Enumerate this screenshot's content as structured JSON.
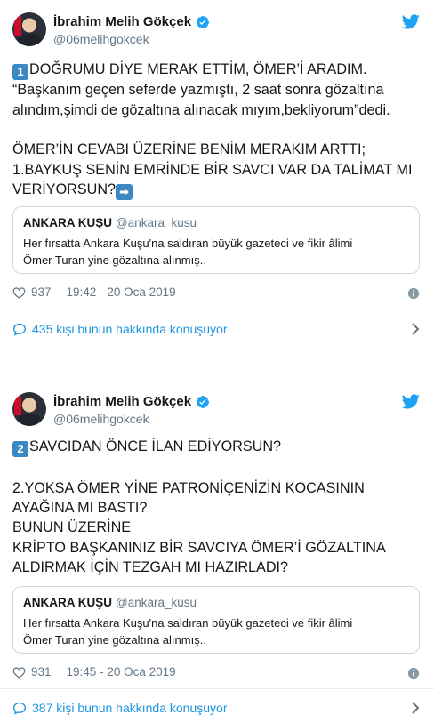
{
  "tweets": [
    {
      "author_name": "İbrahim Melih Gökçek",
      "author_handle": "@06melihgokcek",
      "keycap": "1",
      "line1": "DOĞRUMU DİYE MERAK ETTİM, ÖMER’İ ARADIM.",
      "line2": "“Başkanım geçen seferde yazmıştı, 2 saat sonra gözaltına",
      "line3": "alındım,şimdi de gözaltına alınacak mıyım,bekliyorum”dedi.",
      "line4": "ÖMER’İN CEVABI ÜZERİNE BENİM MERAKIM ARTTI;",
      "line5": "1.BAYKUŞ SENİN EMRİNDE BİR SAVCI VAR DA TALİMAT MI",
      "line6": "VERİYORSUN?",
      "arrow": "➡",
      "quote": {
        "name": "ANKARA KUŞU",
        "handle": "@ankara_kusu",
        "body_line1": "Her fırsatta Ankara Kuşu'na saldıran büyük gazeteci ve fikir âlimi",
        "body_line2": "Ömer Turan yine gözaltına alınmış.."
      },
      "likes": "937",
      "timestamp": "19:42 - 20 Oca 2019",
      "conversation": "435 kişi bunun hakkında konuşuyor"
    },
    {
      "author_name": "İbrahim Melih Gökçek",
      "author_handle": "@06melihgokcek",
      "keycap": "2",
      "line1": "SAVCIDAN ÖNCE İLAN EDİYORSUN?",
      "line2": "2.YOKSA ÖMER YİNE PATRONİÇENİZİN KOCASININ",
      "line3": "AYAĞINA MI BASTI?",
      "line4": "BUNUN ÜZERİNE",
      "line5": "KRİPTO BAŞKANINIZ BİR SAVCIYA ÖMER’İ GÖZALTINA",
      "line6": "ALDIRMAK İÇİN TEZGAH MI HAZIRLADI?",
      "quote": {
        "name": "ANKARA KUŞU",
        "handle": "@ankara_kusu",
        "body_line1": "Her fırsatta Ankara Kuşu'na saldıran büyük gazeteci ve fikir âlimi",
        "body_line2": "Ömer Turan yine gözaltına alınmış.."
      },
      "likes": "931",
      "timestamp": "19:45 - 20 Oca 2019",
      "conversation": "387 kişi bunun hakkında konuşuyor"
    }
  ],
  "icons": {
    "verified": "verified-badge-icon",
    "twitter": "twitter-bird-icon",
    "heart": "heart-icon",
    "info": "info-icon",
    "conversation": "speech-bubble-icon",
    "chevron": "chevron-right-icon"
  },
  "colors": {
    "accent": "#1da1f2",
    "link": "#1b95e0",
    "muted": "#657786",
    "keycap": "#3b88c3",
    "border": "#ccd6dd"
  }
}
